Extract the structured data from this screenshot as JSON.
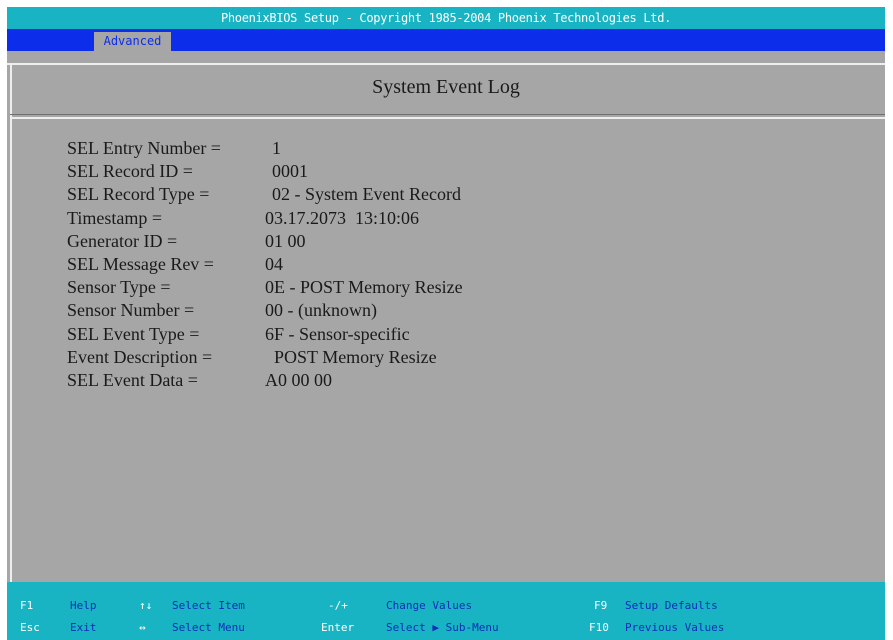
{
  "titlebar": "PhoenixBIOS Setup - Copyright 1985-2004 Phoenix Technologies Ltd.",
  "menu": {
    "active_tab": "Advanced"
  },
  "panel": {
    "title": "System Event Log"
  },
  "entries": [
    {
      "label": "SEL Entry Number =",
      "value": "1"
    },
    {
      "label": "SEL Record ID =",
      "value": "0001"
    },
    {
      "label": "SEL Record Type =",
      "value": "02 - System Event Record"
    },
    {
      "label": "Timestamp =",
      "value": "03.17.2073  13:10:06"
    },
    {
      "label": "Generator ID =",
      "value": "01 00"
    },
    {
      "label": "SEL Message Rev =",
      "value": "04"
    },
    {
      "label": "Sensor Type =",
      "value": "0E - POST Memory Resize"
    },
    {
      "label": "Sensor Number =",
      "value": "00 - (unknown)"
    },
    {
      "label": "SEL Event Type =",
      "value": "6F - Sensor-specific"
    },
    {
      "label": "Event Description =",
      "value": "POST Memory Resize"
    },
    {
      "label": "SEL Event Data =",
      "value": "A0 00 00"
    }
  ],
  "footer": {
    "f1_key": "F1",
    "f1_desc": "Help",
    "updown_key": "↑↓",
    "updown_desc": "Select Item",
    "minusplus_key": "-/+",
    "minusplus_desc": "Change Values",
    "f9_key": "F9",
    "f9_desc": "Setup Defaults",
    "esc_key": "Esc",
    "esc_desc": "Exit",
    "leftright_key": "↔",
    "leftright_desc": "Select Menu",
    "enter_key": "Enter",
    "enter_desc": "Select ▶ Sub-Menu",
    "f10_key": "F10",
    "f10_desc": "Previous Values"
  }
}
